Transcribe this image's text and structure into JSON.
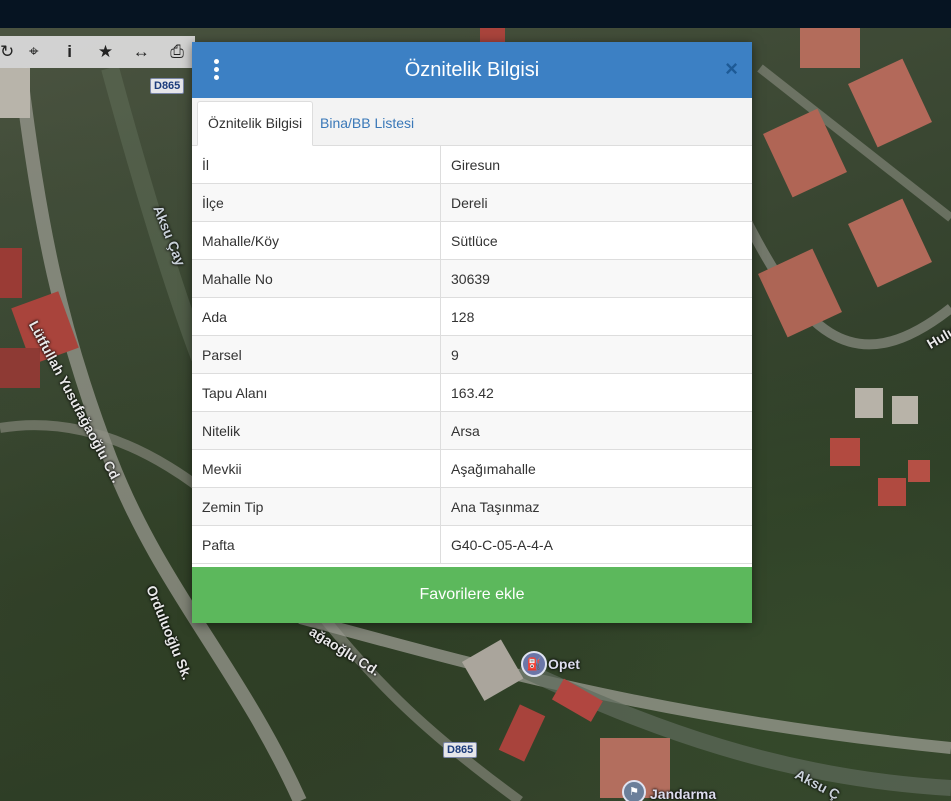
{
  "map": {
    "labels": {
      "street1": "Lütfullah Yusufağaoğlu Cd.",
      "street2": "ağaoğlu Cd.",
      "street3": "Orduluoğlu Sk.",
      "river1": "Aksu Çay",
      "river2": "Aksu Ç",
      "street4": "Hulu",
      "poi1": "Opet",
      "poi2": "Jandarma"
    },
    "shields": {
      "top": "D865",
      "bottom": "D865"
    }
  },
  "toolbar": {
    "items": [
      {
        "name": "refresh-icon",
        "glyph": "↻"
      },
      {
        "name": "crosshair-icon",
        "glyph": "⌖"
      },
      {
        "name": "info-icon",
        "glyph": "i"
      },
      {
        "name": "star-icon",
        "glyph": "★"
      },
      {
        "name": "measure-icon",
        "glyph": "↔"
      },
      {
        "name": "print-icon",
        "glyph": "⎙"
      }
    ]
  },
  "modal": {
    "title": "Öznitelik Bilgisi",
    "close": "×",
    "tabs": [
      "Öznitelik Bilgisi",
      "Bina/BB Listesi"
    ],
    "rows": [
      {
        "key": "İl",
        "value": "Giresun"
      },
      {
        "key": "İlçe",
        "value": "Dereli"
      },
      {
        "key": "Mahalle/Köy",
        "value": "Sütlüce"
      },
      {
        "key": "Mahalle No",
        "value": "30639"
      },
      {
        "key": "Ada",
        "value": "128"
      },
      {
        "key": "Parsel",
        "value": "9"
      },
      {
        "key": "Tapu Alanı",
        "value": "163.42"
      },
      {
        "key": "Nitelik",
        "value": "Arsa"
      },
      {
        "key": "Mevkii",
        "value": "Aşağımahalle"
      },
      {
        "key": "Zemin Tip",
        "value": "Ana Taşınmaz"
      },
      {
        "key": "Pafta",
        "value": "G40-C-05-A-4-A"
      }
    ],
    "favorite_button": "Favorilere ekle"
  },
  "colors": {
    "header": "#3c80c4",
    "button": "#5cb85c",
    "topbar": "#061422"
  }
}
